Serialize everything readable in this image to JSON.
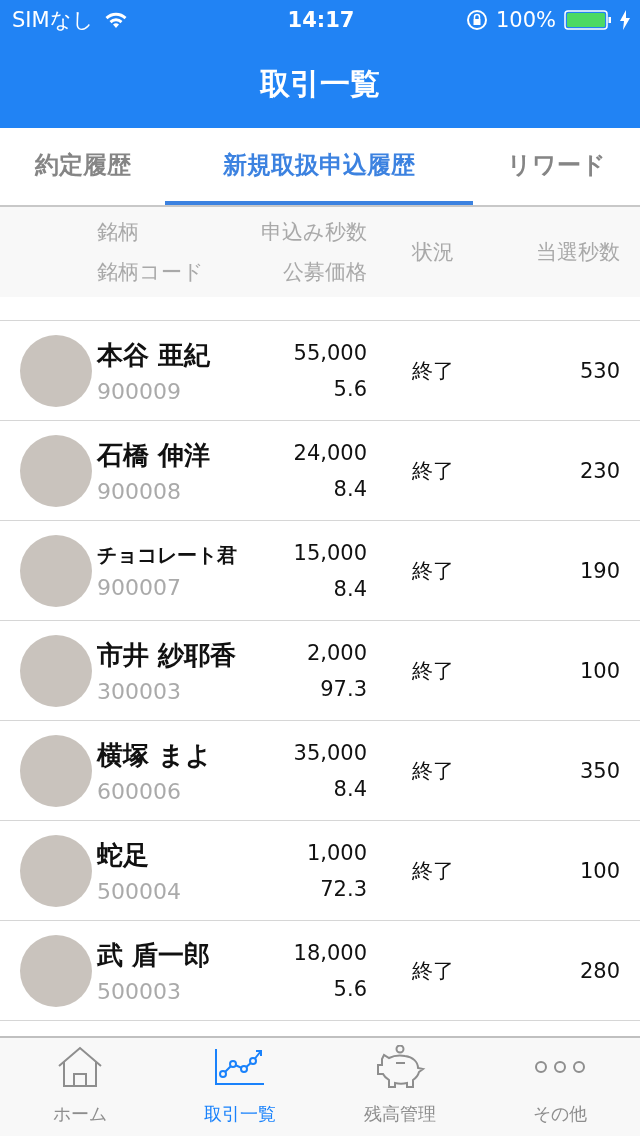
{
  "status_bar": {
    "carrier": "SIMなし",
    "time": "14:17",
    "battery": "100%"
  },
  "nav": {
    "title": "取引一覧"
  },
  "tabs": [
    {
      "label": "約定履歴",
      "selected": false
    },
    {
      "label": "新規取扱申込履歴",
      "selected": true
    },
    {
      "label": "リワード",
      "selected": false
    }
  ],
  "table": {
    "header": {
      "name": "銘柄",
      "code": "銘柄コード",
      "seconds": "申込み秒数",
      "price": "公募価格",
      "status": "状況",
      "won": "当選秒数"
    },
    "rows": [
      {
        "name": "本谷 亜紀",
        "code": "900009",
        "seconds": "55,000",
        "price": "5.6",
        "status": "終了",
        "won": "530"
      },
      {
        "name": "石橋 伸洋",
        "code": "900008",
        "seconds": "24,000",
        "price": "8.4",
        "status": "終了",
        "won": "230"
      },
      {
        "name": "チョコレート君",
        "code": "900007",
        "seconds": "15,000",
        "price": "8.4",
        "status": "終了",
        "won": "190"
      },
      {
        "name": "市井 紗耶香",
        "code": "300003",
        "seconds": "2,000",
        "price": "97.3",
        "status": "終了",
        "won": "100"
      },
      {
        "name": "横塚 まよ",
        "code": "600006",
        "seconds": "35,000",
        "price": "8.4",
        "status": "終了",
        "won": "350"
      },
      {
        "name": "蛇足",
        "code": "500004",
        "seconds": "1,000",
        "price": "72.3",
        "status": "終了",
        "won": "100"
      },
      {
        "name": "武 盾一郎",
        "code": "500003",
        "seconds": "18,000",
        "price": "5.6",
        "status": "終了",
        "won": "280"
      }
    ]
  },
  "tab_bar": [
    {
      "label": "ホーム",
      "selected": false
    },
    {
      "label": "取引一覧",
      "selected": true
    },
    {
      "label": "残高管理",
      "selected": false
    },
    {
      "label": "その他",
      "selected": false
    }
  ]
}
